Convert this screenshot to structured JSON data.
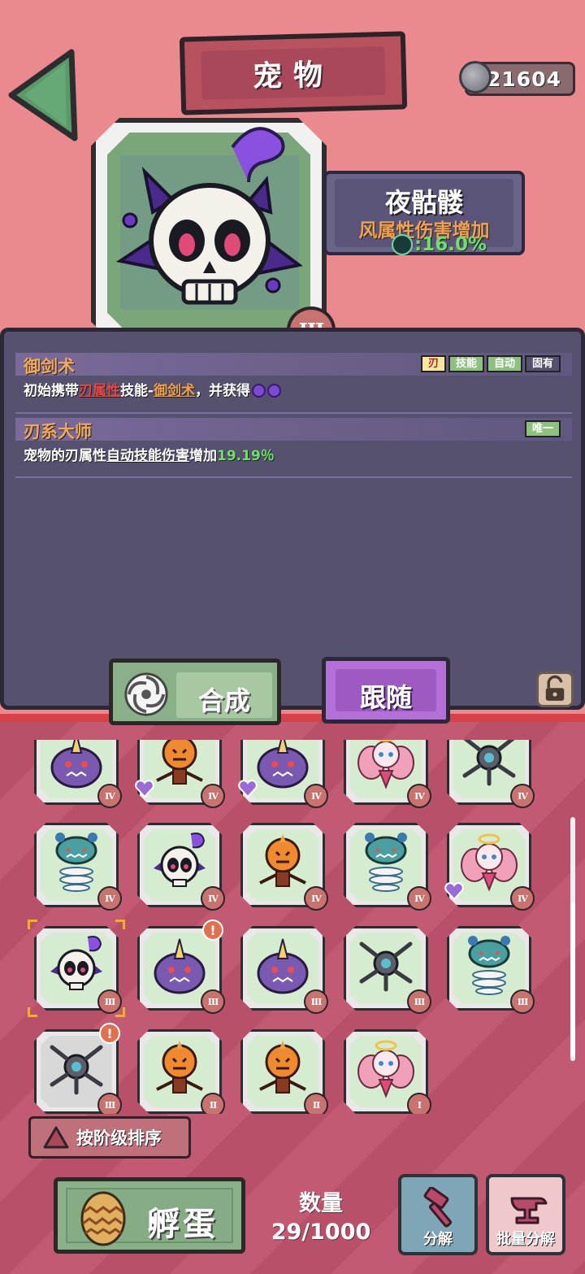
{
  "header": {
    "title": "宠物",
    "currency": "21604"
  },
  "pet": {
    "name": "夜骷髅",
    "bonus_label": "风属性伤害增加",
    "bonus_value": ":16.0%",
    "tier": "III"
  },
  "skills": [
    {
      "name": "御剑术",
      "tags": [
        "刃",
        "技能",
        "自动",
        "固有"
      ],
      "desc_parts": [
        "初始携带",
        "刃属性",
        "技能-",
        "御剑术",
        "，并获得"
      ]
    },
    {
      "name": "刃系大师",
      "tags": [
        "唯一"
      ],
      "desc_parts": [
        "宠物的刃属性",
        "自动技能伤害",
        "增加",
        "19.19％"
      ]
    }
  ],
  "actions": {
    "synthesize": "合成",
    "follow": "跟随"
  },
  "pet_list": [
    {
      "type": "purple-horn",
      "tier": "IV"
    },
    {
      "type": "pumpkin",
      "tier": "IV",
      "heart": true
    },
    {
      "type": "purple-horn",
      "tier": "IV",
      "heart": true
    },
    {
      "type": "pink-fairy",
      "tier": "IV"
    },
    {
      "type": "drone",
      "tier": "IV"
    },
    {
      "type": "spring-bot",
      "tier": "IV"
    },
    {
      "type": "skull",
      "tier": "IV"
    },
    {
      "type": "pumpkin",
      "tier": "IV"
    },
    {
      "type": "spring-bot",
      "tier": "IV"
    },
    {
      "type": "pink-fairy",
      "tier": "IV",
      "heart": true
    },
    {
      "type": "skull",
      "tier": "III",
      "selected": true
    },
    {
      "type": "purple-horn",
      "tier": "III",
      "alert": true
    },
    {
      "type": "purple-horn",
      "tier": "III"
    },
    {
      "type": "drone",
      "tier": "III"
    },
    {
      "type": "spring-bot",
      "tier": "III"
    },
    {
      "type": "drone",
      "tier": "III",
      "alert": true,
      "grey": true
    },
    {
      "type": "pumpkin",
      "tier": "II"
    },
    {
      "type": "pumpkin",
      "tier": "II"
    },
    {
      "type": "pink-fairy",
      "tier": "I"
    }
  ],
  "sort_label": "按阶级排序",
  "bottom": {
    "hatch": "孵蛋",
    "count_label": "数量",
    "count_value": "29/1000",
    "decompose": "分解",
    "batch_decompose": "批量分解"
  },
  "colors": {
    "tier_badge": "#c8736f",
    "follow_button": "#b56fd8",
    "synth_button": "#8ab08a",
    "highlight_green": "#6ee06a",
    "highlight_orange": "#f0a050"
  }
}
